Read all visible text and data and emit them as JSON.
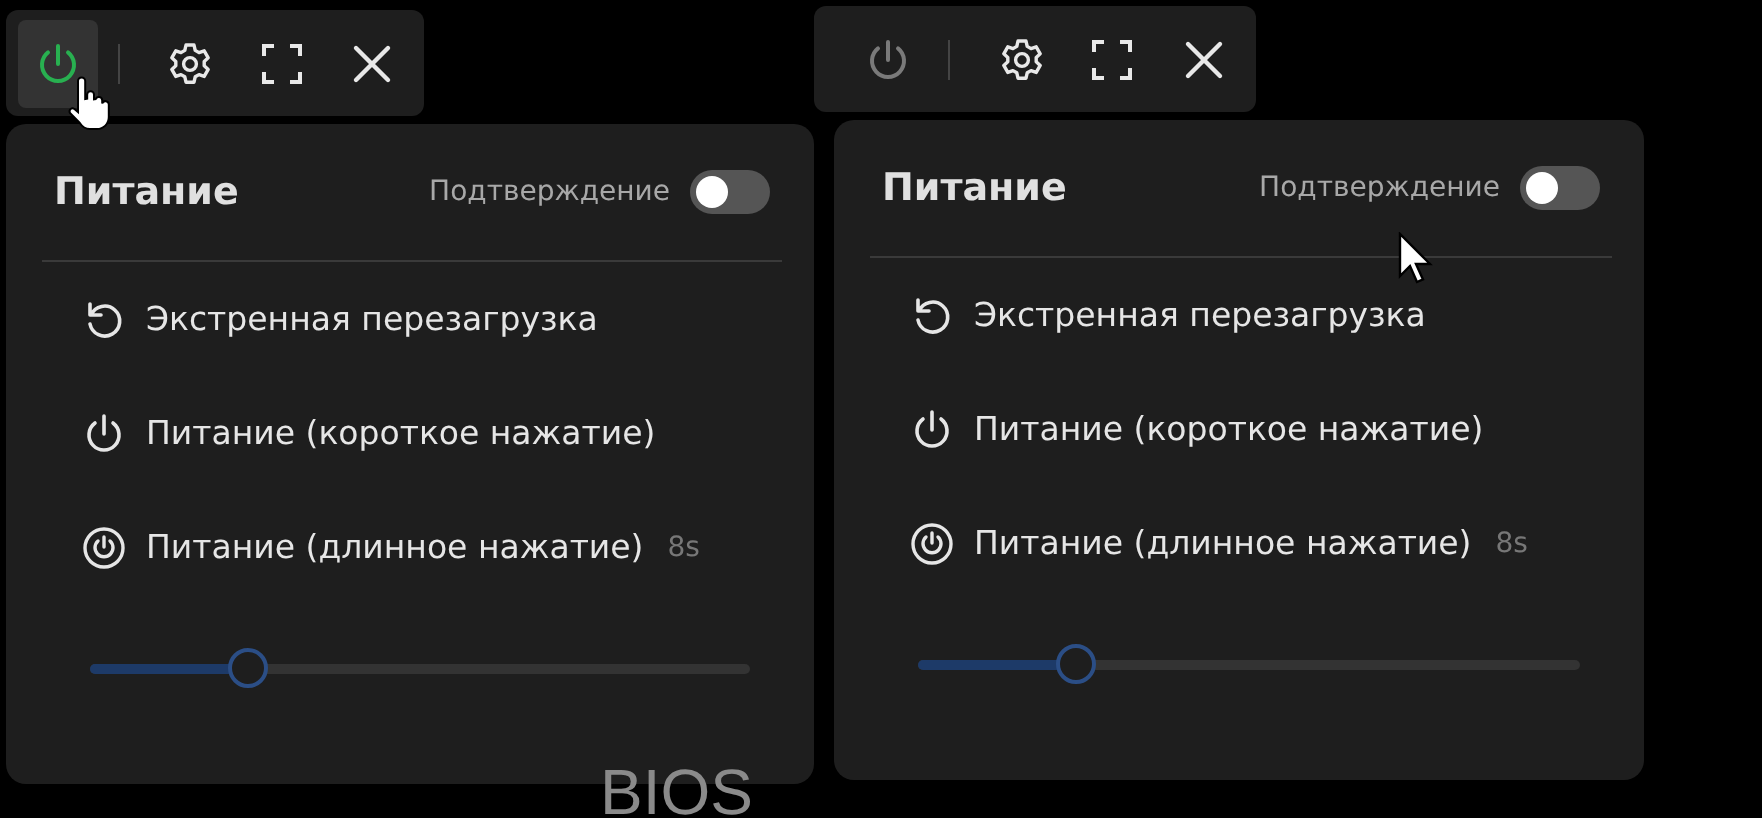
{
  "views": [
    {
      "toolbar": {
        "power_active": true
      },
      "cursor": {
        "kind": "hand"
      },
      "panel": {
        "title": "Питание",
        "confirm": {
          "label": "Подтверждение",
          "on": false
        },
        "actions": [
          {
            "kind": "restart",
            "label": "Экстренная перезагрузка"
          },
          {
            "kind": "power",
            "label": "Питание (короткое нажатие)"
          },
          {
            "kind": "power-long",
            "label": "Питание (длинное нажатие)",
            "hint": "8s"
          }
        ],
        "slider": {
          "level": 0.24
        }
      },
      "backdrop_text": "BIOS"
    },
    {
      "toolbar": {
        "power_active": false
      },
      "cursor": {
        "kind": "arrow"
      },
      "panel": {
        "title": "Питание",
        "confirm": {
          "label": "Подтверждение",
          "on": false
        },
        "actions": [
          {
            "kind": "restart",
            "label": "Экстренная перезагрузка"
          },
          {
            "kind": "power",
            "label": "Питание (короткое нажатие)"
          },
          {
            "kind": "power-long",
            "label": "Питание (длинное нажатие)",
            "hint": "8s"
          }
        ],
        "slider": {
          "level": 0.24
        }
      }
    }
  ]
}
